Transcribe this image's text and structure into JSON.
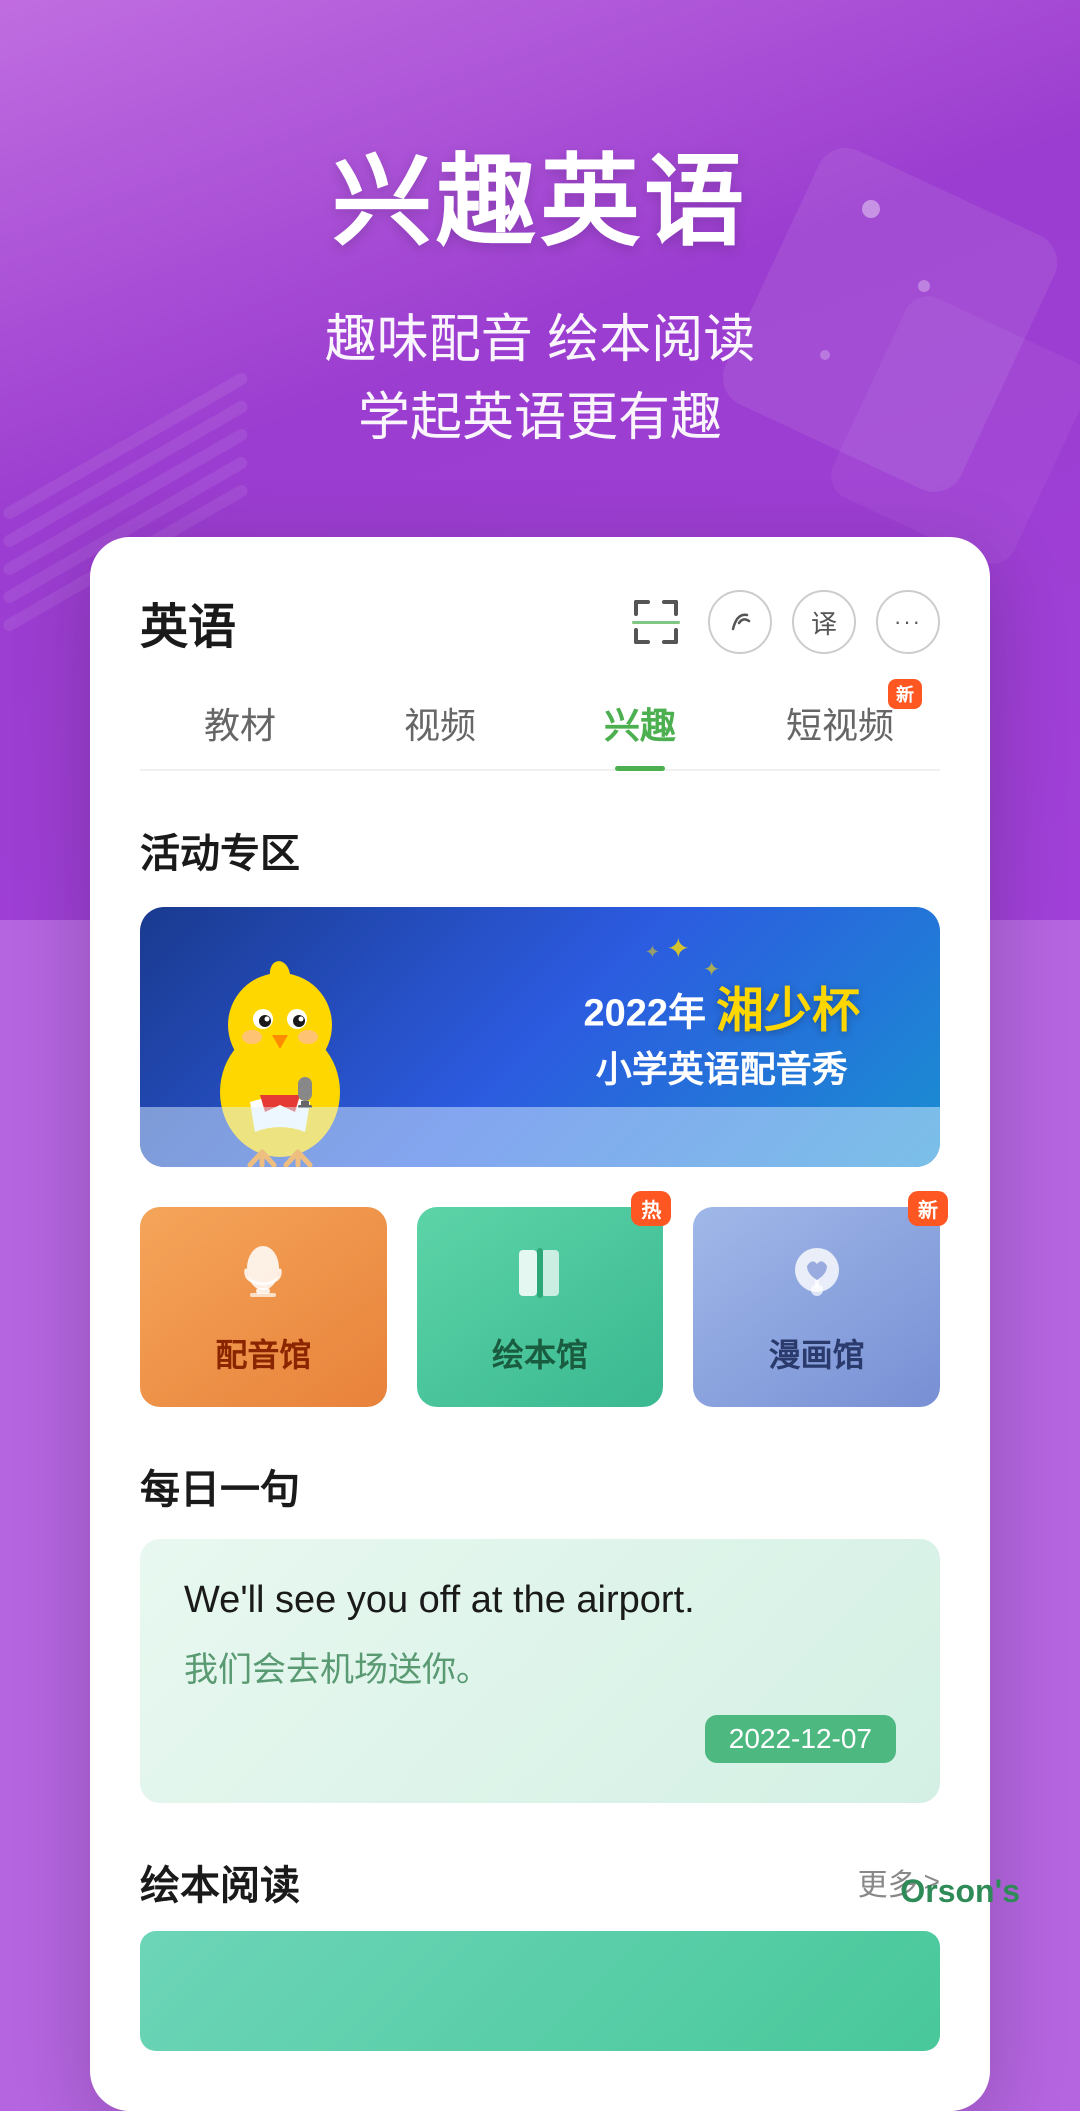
{
  "hero": {
    "title": "兴趣英语",
    "subtitle_line1": "趣味配音 绘本阅读",
    "subtitle_line2": "学起英语更有趣"
  },
  "card": {
    "title": "英语",
    "tabs": [
      {
        "label": "教材",
        "active": false,
        "badge": null
      },
      {
        "label": "视频",
        "active": false,
        "badge": null
      },
      {
        "label": "兴趣",
        "active": true,
        "badge": null
      },
      {
        "label": "短视频",
        "active": false,
        "badge": "新"
      }
    ],
    "activity_section": {
      "title": "活动专区",
      "banner": {
        "year": "2022年",
        "title_line1": "湘少杯",
        "title_line2": "小学英语配音秀"
      }
    },
    "features": [
      {
        "label": "配音馆",
        "badge": null,
        "type": "dubbing"
      },
      {
        "label": "绘本馆",
        "badge": "热",
        "type": "picture"
      },
      {
        "label": "漫画馆",
        "badge": "新",
        "type": "manga"
      }
    ],
    "daily_section": {
      "title": "每日一句",
      "english": "We'll see you off at the airport.",
      "chinese": "我们会去机场送你。",
      "date": "2022-12-07"
    },
    "reading_section": {
      "title": "绘本阅读",
      "more_label": "更多",
      "arrow": ">"
    }
  },
  "watermark": "Orson's"
}
